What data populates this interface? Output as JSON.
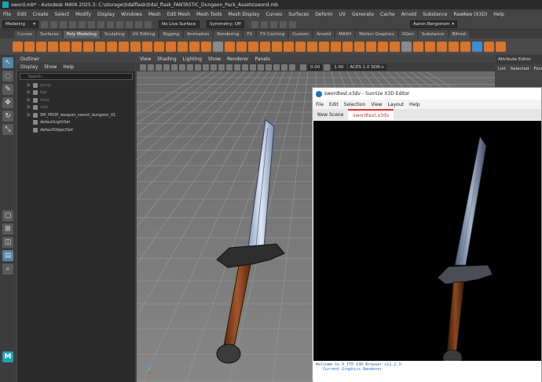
{
  "maya": {
    "title": "sword.mb* - Autodesk MAYA 2025.3: C:\\storage\\tidalflask\\tidal_flask_FANTASTIC_Dungeon_Pack_Assets\\sword.mb",
    "menus": [
      "File",
      "Edit",
      "Create",
      "Select",
      "Modify",
      "Display",
      "Windows",
      "Mesh",
      "Edit Mesh",
      "Mesh Tools",
      "Mesh Display",
      "Curves",
      "Surfaces",
      "Deform",
      "UV",
      "Generate",
      "Cache",
      "Arnold",
      "Substance",
      "RawKee (X3D)",
      "Help"
    ],
    "workspace_mode": "Modeling",
    "live_surface": "No Live Surface",
    "symmetry": "Symmetry: Off",
    "user": "Aaron Bergstrom",
    "shelf_tabs": [
      "Curves",
      "Surfaces",
      "Poly Modeling",
      "Sculpting",
      "UV Editing",
      "Rigging",
      "Animation",
      "Rendering",
      "FX",
      "FX Caching",
      "Custom",
      "Arnold",
      "MASH",
      "Motion Graphics",
      "XGen",
      "Substance",
      "Bifrost"
    ],
    "active_shelf_tab": "Poly Modeling"
  },
  "outliner": {
    "title": "Outliner",
    "menus": [
      "Display",
      "Show",
      "Help"
    ],
    "search_placeholder": "Search...",
    "items": [
      {
        "label": "persp",
        "dim": true
      },
      {
        "label": "top",
        "dim": true
      },
      {
        "label": "front",
        "dim": true
      },
      {
        "label": "side",
        "dim": true
      },
      {
        "label": "SM_PROP_weapon_sword_dungeon_01",
        "dim": false
      },
      {
        "label": "defaultLightSet",
        "dim": false
      },
      {
        "label": "defaultObjectSet",
        "dim": false
      }
    ]
  },
  "viewport": {
    "menus": [
      "View",
      "Shading",
      "Lighting",
      "Show",
      "Renderer",
      "Panels"
    ],
    "value_a": "0.00",
    "value_b": "1.00",
    "color_space": "ACES 1.0 SDR-v"
  },
  "attribute_editor": {
    "title": "Attribute Editor",
    "menus": [
      "List",
      "Selected",
      "Focus"
    ]
  },
  "sunrize": {
    "title": "swordtest.x3dv - Sunrize X3D Editor",
    "menus": [
      "File",
      "Edit",
      "Selection",
      "View",
      "Layout",
      "Help"
    ],
    "tabs": [
      {
        "label": "New Scene",
        "active": false
      },
      {
        "label": "swordtest.x3dv",
        "active": true
      }
    ],
    "console": "Welcome to X_ITE X3D Browser v11.2.3:\n   Current Graphics Renderer"
  },
  "colors": {
    "accent": "#d9742a",
    "selection": "#5285a6",
    "tab_active": "#dd3333"
  }
}
